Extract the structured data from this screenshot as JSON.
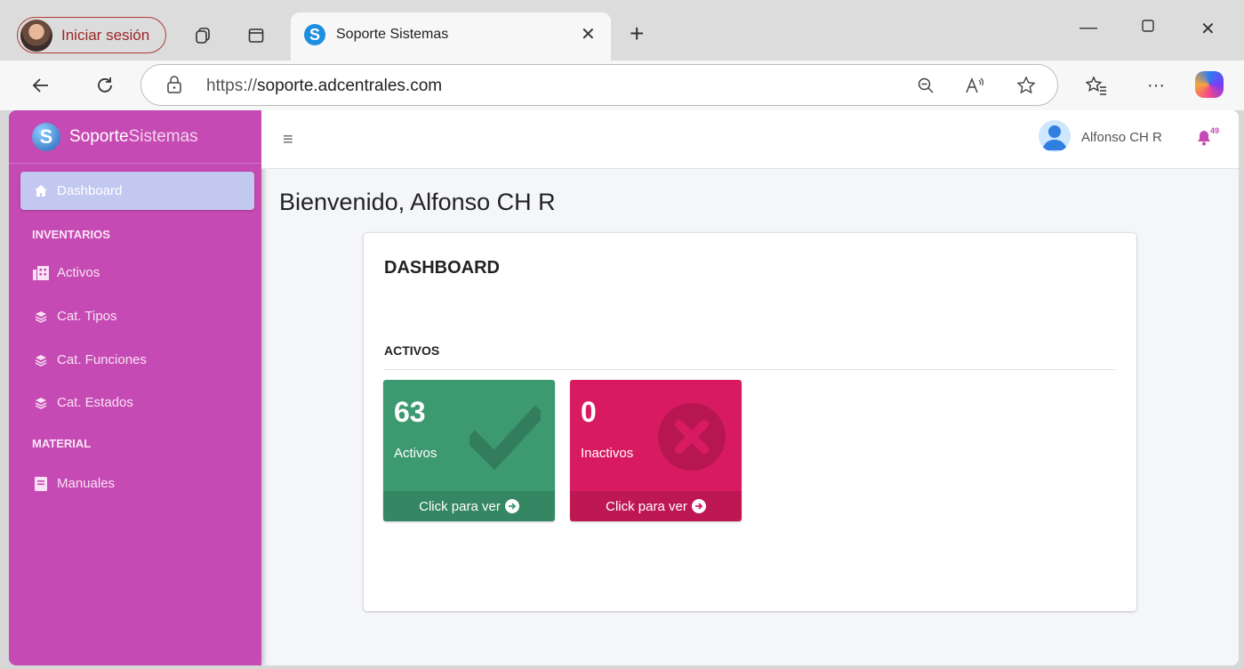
{
  "browser": {
    "profile_label": "Iniciar sesión",
    "tab_title": "Soporte Sistemas",
    "tab_favicon": "S",
    "url_scheme": "https://",
    "url_host": "soporte.adcentrales.com"
  },
  "sidebar": {
    "brand_logo": "S",
    "brand_bold": "Soporte",
    "brand_light": "Sistemas",
    "items": [
      {
        "label": "Dashboard",
        "icon": "home-icon",
        "active": true
      },
      {
        "label": "Activos",
        "icon": "building-icon"
      },
      {
        "label": "Cat. Tipos",
        "icon": "layers-icon"
      },
      {
        "label": "Cat. Funciones",
        "icon": "layers-icon"
      },
      {
        "label": "Cat. Estados",
        "icon": "layers-icon"
      },
      {
        "label": "Manuales",
        "icon": "book-icon"
      }
    ],
    "headers": [
      "INVENTARIOS",
      "MATERIAL"
    ]
  },
  "topnav": {
    "user_name": "Alfonso CH R",
    "notification_count": "49"
  },
  "main": {
    "welcome": "Bienvenido, Alfonso CH R",
    "card_title": "DASHBOARD",
    "section_title": "ACTIVOS",
    "stats": [
      {
        "count": "63",
        "label": "Activos",
        "link": "Click para ver",
        "color": "#3d9970",
        "icon": "check-icon"
      },
      {
        "count": "0",
        "label": "Inactivos",
        "link": "Click para ver",
        "color": "#d81b60",
        "icon": "times-circle-icon"
      }
    ]
  },
  "colors": {
    "sidebar_bg": "#c64ab3",
    "active_item_bg": "#c3c8f0",
    "content_bg": "#f4f6f9"
  }
}
